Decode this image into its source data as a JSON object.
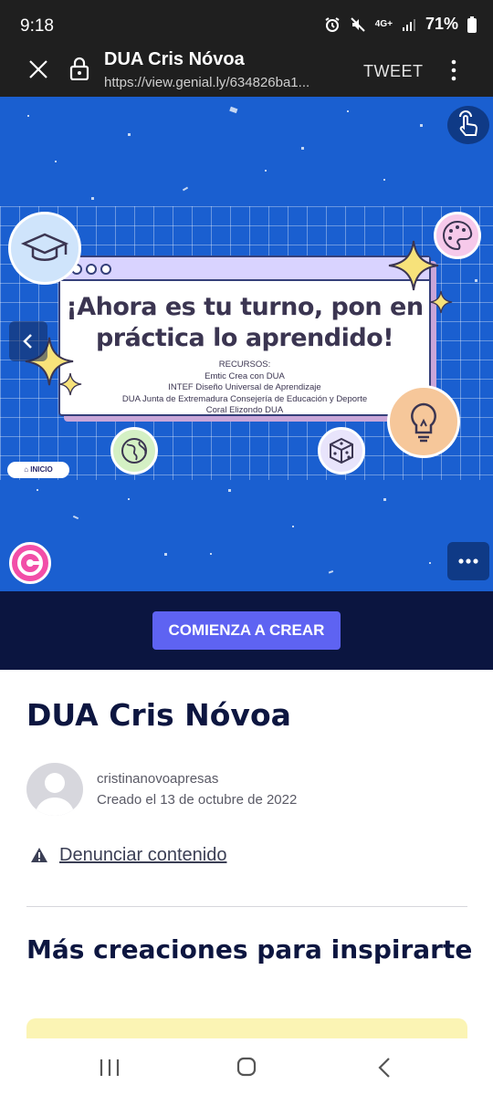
{
  "status_bar": {
    "time": "9:18",
    "network": "4G+",
    "battery": "71%",
    "icons": [
      "alarm-icon",
      "mute-icon",
      "network-icon",
      "signal-icon",
      "battery-icon"
    ]
  },
  "browser": {
    "title": "DUA Cris Nóvoa",
    "url": "https://view.genial.ly/634826ba1...",
    "tweet_label": "TWEET",
    "icons": [
      "close-icon",
      "lock-icon",
      "kebab-menu-icon"
    ]
  },
  "slide": {
    "heading_line1": "¡Ahora es tu turno, pon en",
    "heading_line2": "práctica lo aprendido!",
    "resources_title": "RECURSOS:",
    "resources": [
      "Emtic Crea con DUA",
      "INTEF Diseño Universal de Aprendizaje",
      "DUA Junta de Extremadura Consejería de Educación y Deporte",
      "Coral Elizondo DUA"
    ],
    "inicio_label": "INICIO",
    "icons": [
      "graduation-cap-icon",
      "palette-icon",
      "lightbulb-icon",
      "globe-icon",
      "dice-icon",
      "sparkle-icon"
    ],
    "colors": {
      "background": "#1a5fd0",
      "card_header": "#d9d3ff",
      "text": "#3b3551"
    }
  },
  "cta": {
    "label": "COMIENZA A CREAR",
    "color": "#5e63f2"
  },
  "details": {
    "title": "DUA Cris Nóvoa",
    "author": "cristinanovoapresas",
    "created": "Creado el  13 de octubre de 2022",
    "report_label": "Denunciar contenido"
  },
  "more": {
    "title": "Más creaciones para inspirarte"
  },
  "nav": {
    "icons": [
      "recent-apps-icon",
      "home-icon",
      "back-icon"
    ]
  }
}
